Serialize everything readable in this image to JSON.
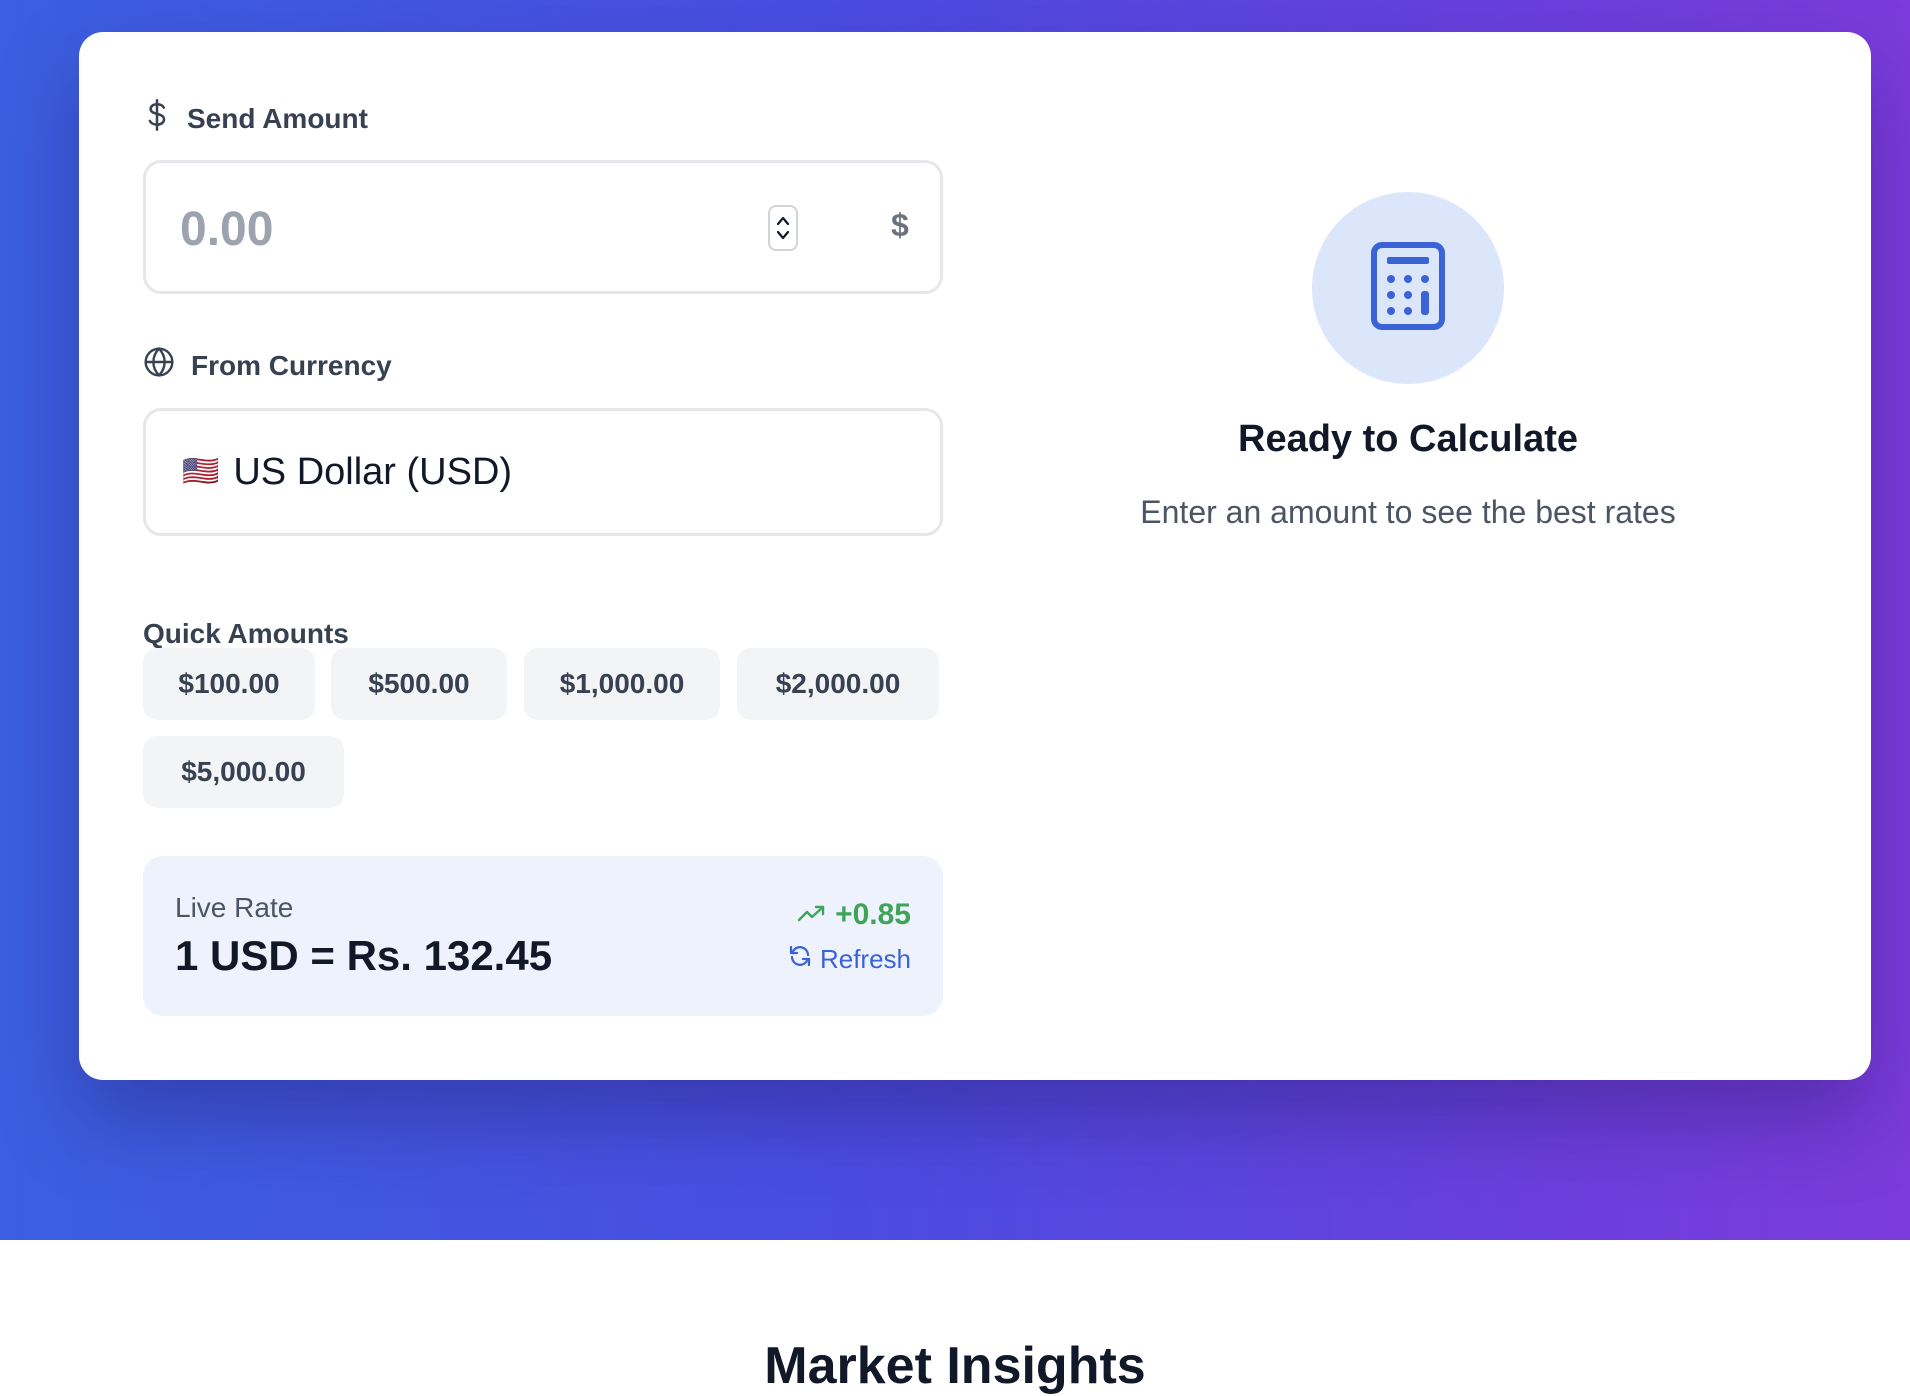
{
  "send_amount": {
    "label": "Send Amount",
    "placeholder": "0.00",
    "value": "",
    "suffix": "$"
  },
  "from_currency": {
    "label": "From Currency",
    "flag": "🇺🇸",
    "selected": "US Dollar (USD)"
  },
  "quick_amounts": {
    "title": "Quick Amounts",
    "items": [
      "$100.00",
      "$500.00",
      "$1,000.00",
      "$2,000.00",
      "$5,000.00"
    ]
  },
  "live_rate": {
    "label": "Live Rate",
    "value": "1 USD = Rs. 132.45",
    "change": "+0.85",
    "refresh_label": "Refresh"
  },
  "result_panel": {
    "icon": "calculator-icon",
    "title": "Ready to Calculate",
    "subtitle": "Enter an amount to see the best rates"
  },
  "market_insights": {
    "title": "Market Insights"
  },
  "colors": {
    "gradient_start": "#3b5fe0",
    "gradient_end": "#7c3bdc",
    "accent_blue": "#3b63d8",
    "positive_green": "#3fa35a",
    "rate_box_bg": "#eef2fd",
    "icon_circle_bg": "#dbe6fb"
  }
}
